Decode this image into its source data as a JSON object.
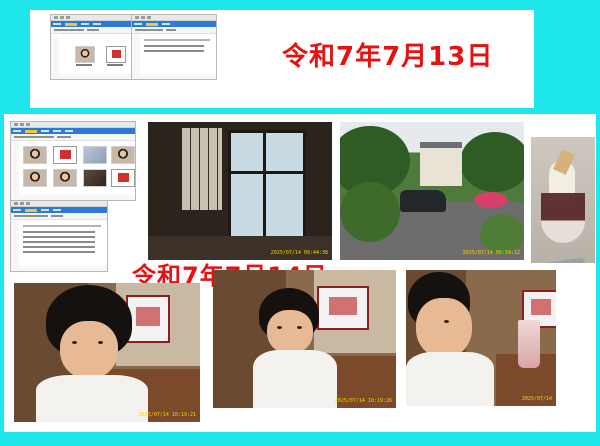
{
  "dates": {
    "day1": "令和7年7月13日",
    "day2": "令和7年7月14日"
  },
  "colors": {
    "background": "#1ee6ea",
    "date_text": "#e81010",
    "timestamp": "#ffd200"
  },
  "photos": {
    "room_stamp": "2025/07/14 09:44:38",
    "garden_stamp": "2025/07/14 09:54:12",
    "kid1_stamp": "2025/07/14 10:19:21",
    "kid2_stamp": "2025/07/14 10:19:26",
    "kid3_stamp": "2025/07/14"
  },
  "icons": {
    "explorer_thumbnail": "photo-thumbnail-icon",
    "folder_window": "file-explorer-window-icon"
  }
}
